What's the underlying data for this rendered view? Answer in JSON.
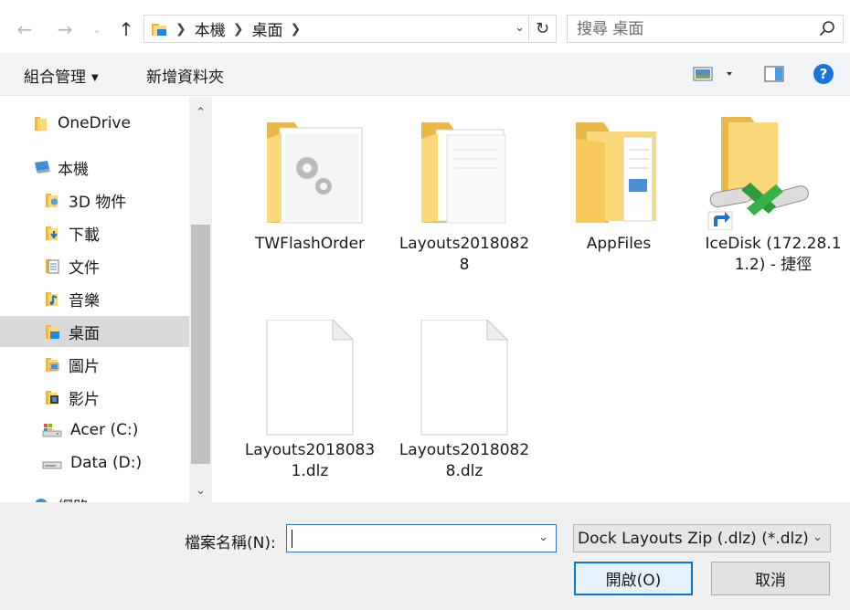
{
  "address": {
    "crumbs": [
      "本機",
      "桌面"
    ]
  },
  "search": {
    "placeholder": "搜尋 桌面"
  },
  "toolbar": {
    "organize_label": "組合管理",
    "new_folder_label": "新增資料夾"
  },
  "nav": {
    "items": [
      {
        "label": "OneDrive"
      },
      {
        "label": "本機"
      },
      {
        "label": "3D 物件"
      },
      {
        "label": "下載"
      },
      {
        "label": "文件"
      },
      {
        "label": "音樂"
      },
      {
        "label": "桌面"
      },
      {
        "label": "圖片"
      },
      {
        "label": "影片"
      },
      {
        "label": "Acer (C:)"
      },
      {
        "label": "Data (D:)"
      },
      {
        "label": "網路"
      }
    ]
  },
  "files": [
    {
      "name": "TWFlashOrder",
      "icon": "folder-settings-icon"
    },
    {
      "name": "Layouts20180828",
      "icon": "folder-docs-icon"
    },
    {
      "name": "AppFiles",
      "icon": "folder-docs-icon"
    },
    {
      "name": "IceDisk (172.28.11.2) - 捷徑",
      "icon": "network-drive-shortcut-icon"
    },
    {
      "name": "Layouts20180831.dlz",
      "icon": "file-icon"
    },
    {
      "name": "Layouts20180828.dlz",
      "icon": "file-icon"
    }
  ],
  "bottom": {
    "filename_label": "檔案名稱(N):",
    "filename_value": "",
    "filetype_value": "Dock Layouts Zip (.dlz) (*.dlz)",
    "open_label": "開啟(O)",
    "cancel_label": "取消"
  },
  "colors": {
    "folder": "#fbd97a",
    "selection": "#d9d9d9",
    "accent": "#0078d7"
  }
}
